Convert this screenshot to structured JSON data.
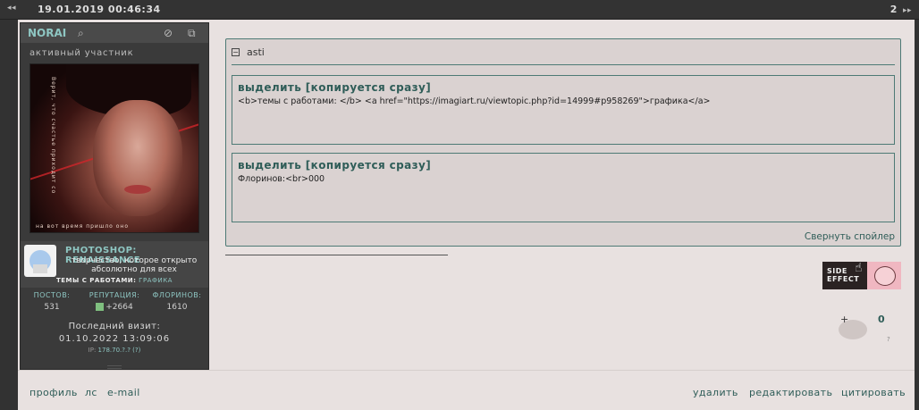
{
  "topbar": {
    "date": "19.01.2019 00:46:34",
    "post_number": "2",
    "nav_left": "◂◂",
    "nav_right": "▸▸"
  },
  "profile": {
    "nick": "NORAI",
    "status": "активный участник",
    "avatar_vertical_text": "Верит, что счастье приходит со",
    "avatar_bottom_text": "на вот время пришло оно",
    "group": {
      "name": "PHOTOSHOP: RENAISSANCE",
      "desc": "творчество, которое открыто абсолютно для всех",
      "links_label": "ТЕМЫ С РАБОТАМИ:",
      "links_value": "ГРАФИКА"
    },
    "stats": {
      "posts_label": "ПОСТОВ:",
      "posts": "531",
      "rep_label": "РЕПУТАЦИЯ:",
      "rep": "+2664",
      "florins_label": "ФЛОРИНОВ:",
      "florins": "1610"
    },
    "last_visit_label": "Последний визит:",
    "last_visit": "01.10.2022 13:09:06",
    "ip_label": "IP:",
    "ip": "178.70.?.? (?)"
  },
  "spoiler": {
    "title": "asti",
    "toggle": "−",
    "collapse": "Свернуть спойлер",
    "code_blocks": [
      {
        "title": "выделить [копируется сразу]",
        "code": "<b>темы с работами: </b> <a href=\"https://imagiart.ru/viewtopic.php?id=14999#p958269\">графика</a>"
      },
      {
        "title": "выделить [копируется сразу]",
        "code": "Флоринов:<br>000"
      }
    ]
  },
  "signature": {
    "banner_text_1": "SIDE",
    "banner_text_2": "EFFECT"
  },
  "rating": {
    "plus": "+",
    "score": "0",
    "question": "?"
  },
  "footer": {
    "left": [
      "профиль",
      "лс",
      "e-mail"
    ],
    "right": [
      "удалить",
      "редактировать",
      "цитировать"
    ]
  },
  "colors": {
    "accent": "#2f5d58",
    "accent_light": "#8ec6c2",
    "post_bg": "#e8e1e0",
    "profile_bg": "#3a3a3a"
  }
}
